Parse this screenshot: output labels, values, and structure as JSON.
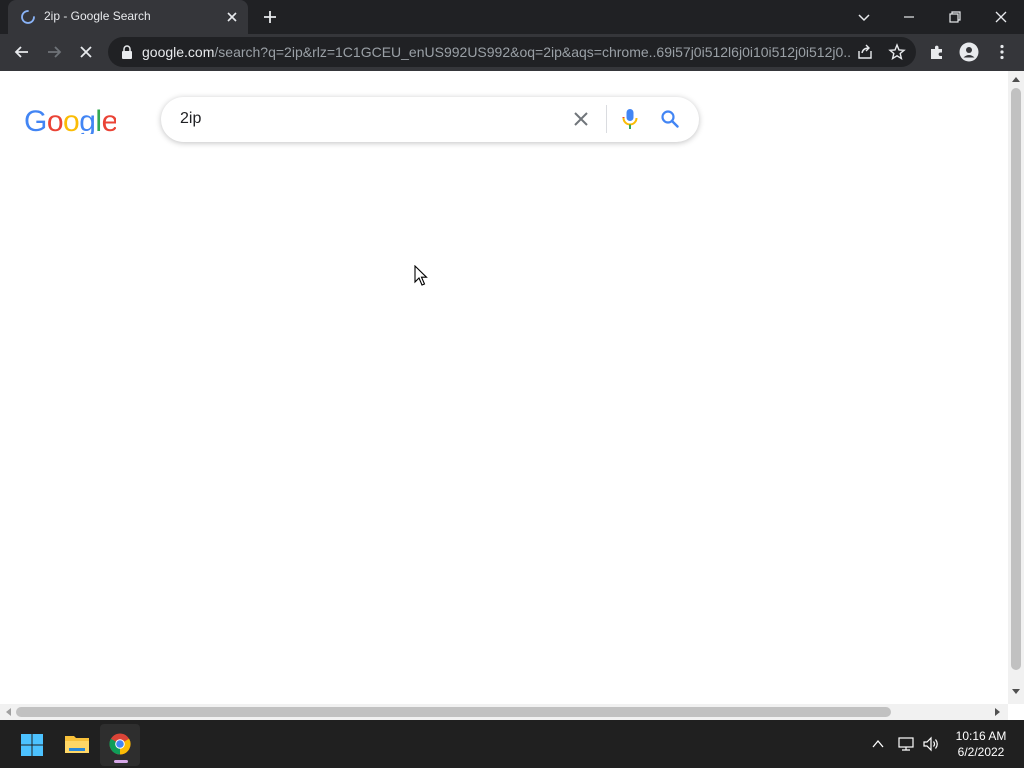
{
  "browser": {
    "tab": {
      "title": "2ip - Google Search"
    },
    "address_bar": {
      "host": "google.com",
      "path": "/search?q=2ip&rlz=1C1GCEU_enUS992US992&oq=2ip&aqs=chrome..69i57j0i512l6j0i10i512j0i512j0..."
    }
  },
  "page": {
    "logo_text": "Google",
    "search": {
      "query": "2ip"
    }
  },
  "taskbar": {
    "clock": {
      "time": "10:16 AM",
      "date": "6/2/2022"
    }
  },
  "icons": {
    "tab_spinner": "loading-spinner-icon",
    "tab_close": "close-icon",
    "new_tab": "plus-icon",
    "back": "arrow-left-icon",
    "forward": "arrow-right-icon",
    "stop": "x-icon",
    "lock": "lock-icon",
    "share": "share-icon",
    "bookmark": "star-icon",
    "extensions": "puzzle-icon",
    "profile": "person-icon",
    "menu": "kebab-icon",
    "clear": "x-icon",
    "mic": "microphone-icon",
    "search": "magnifier-icon"
  },
  "colors": {
    "titlebar": "#202124",
    "toolbar": "#35363a",
    "google_blue": "#4285F4",
    "google_red": "#EA4335",
    "google_yellow": "#FBBC05",
    "google_green": "#34A853",
    "taskbar": "#202020"
  }
}
